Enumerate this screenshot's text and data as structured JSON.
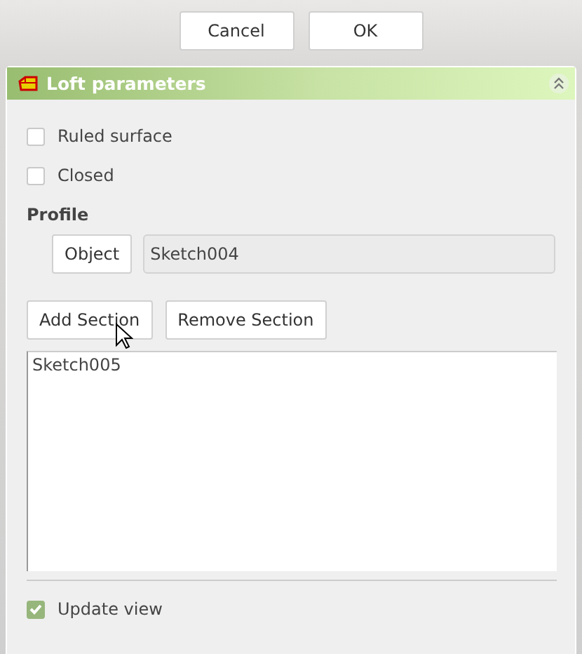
{
  "dialog_buttons": [
    {
      "label": "Cancel"
    },
    {
      "label": "OK"
    }
  ],
  "panel": {
    "title": "Loft parameters",
    "expanded": true,
    "options": [
      {
        "label": "Ruled surface",
        "checked": false
      },
      {
        "label": "Closed",
        "checked": false
      }
    ],
    "profile": {
      "label": "Profile",
      "button": "Object",
      "value": "Sketch004"
    },
    "section_buttons": [
      {
        "label": "Add Section"
      },
      {
        "label": "Remove Section"
      }
    ],
    "sections": [
      {
        "label": "Sketch005"
      }
    ],
    "update_view": {
      "label": "Update view",
      "checked": true
    }
  }
}
